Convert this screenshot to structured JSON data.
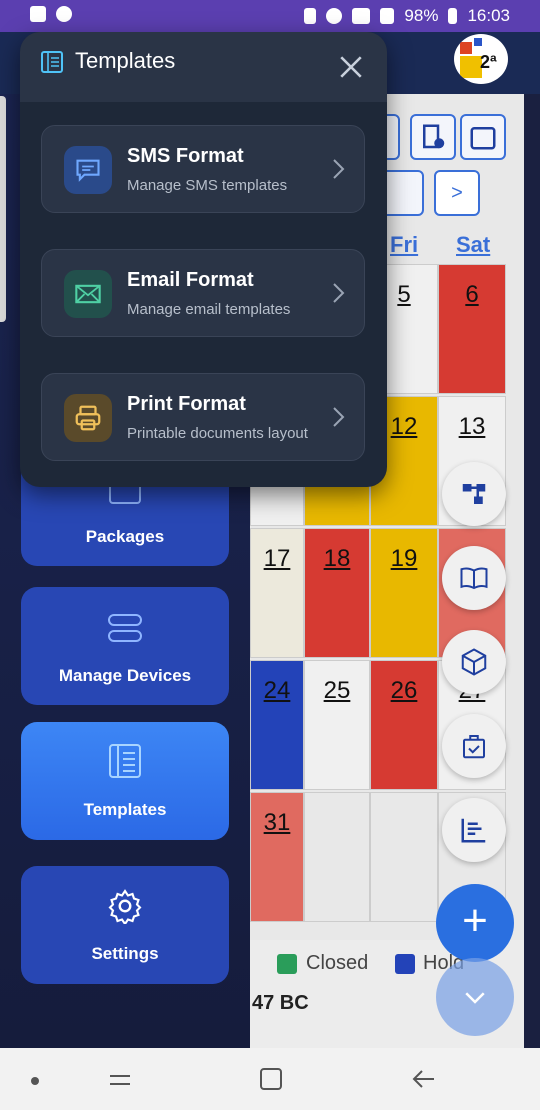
{
  "status_bar": {
    "battery": "98%",
    "time": "16:03"
  },
  "calendar": {
    "nav_next": ">",
    "day_headers": [
      "Fri",
      "Sat"
    ],
    "rows": [
      [
        {
          "d": "",
          "c": "#f0f0f0"
        },
        {
          "d": "",
          "c": "#f0f0f0"
        },
        {
          "d": "5",
          "c": "#f0f0f0"
        },
        {
          "d": "6",
          "c": "#d63a32"
        }
      ],
      [
        {
          "d": "",
          "c": "#f0f0f0"
        },
        {
          "d": "",
          "c": "#e8b800"
        },
        {
          "d": "12",
          "c": "#e8b800"
        },
        {
          "d": "13",
          "c": "#f0f0f0"
        }
      ],
      [
        {
          "d": "17",
          "c": "#ece9dc"
        },
        {
          "d": "18",
          "c": "#d63a32"
        },
        {
          "d": "19",
          "c": "#e8b800"
        },
        {
          "d": "",
          "c": "#e06a60"
        }
      ],
      [
        {
          "d": "24",
          "c": "#2343b8"
        },
        {
          "d": "25",
          "c": "#f0f0f0"
        },
        {
          "d": "26",
          "c": "#d63a32"
        },
        {
          "d": "27",
          "c": "#f0f0f0"
        }
      ],
      [
        {
          "d": "31",
          "c": "#e06a60"
        },
        {
          "d": "",
          "c": "#e8e8e8"
        },
        {
          "d": "",
          "c": "#e8e8e8"
        },
        {
          "d": "",
          "c": "#e8e8e8"
        }
      ]
    ]
  },
  "legend": {
    "closed_label": "Closed",
    "hold_label": "Hold",
    "closed_color": "#2a9d5a",
    "hold_color": "#2343b8",
    "bottom_text": "47 BC"
  },
  "sidebar": {
    "items": [
      {
        "label": "Packages"
      },
      {
        "label": "Manage Devices"
      },
      {
        "label": "Templates"
      },
      {
        "label": "Settings"
      }
    ]
  },
  "popup": {
    "title": "Templates",
    "items": [
      {
        "title": "SMS Format",
        "subtitle": "Manage SMS templates",
        "icon": "sms-icon",
        "color": "#3a72e8"
      },
      {
        "title": "Email Format",
        "subtitle": "Manage email templates",
        "icon": "email-icon",
        "color": "#3db896"
      },
      {
        "title": "Print Format",
        "subtitle": "Printable documents layout",
        "icon": "printer-icon",
        "color": "#e8b84a"
      }
    ]
  },
  "fab": {
    "add_label": "+"
  }
}
